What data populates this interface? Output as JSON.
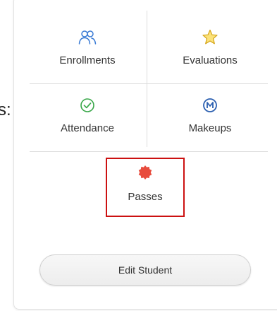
{
  "edge_text": "s:",
  "menu": {
    "enrollments": {
      "label": "Enrollments",
      "icon": "users-icon",
      "color": "#3a7bd5"
    },
    "evaluations": {
      "label": "Evaluations",
      "icon": "star-icon",
      "color": "#f2c230"
    },
    "attendance": {
      "label": "Attendance",
      "icon": "check-circle-icon",
      "color": "#3aa84a"
    },
    "makeups": {
      "label": "Makeups",
      "icon": "m-circle-icon",
      "color": "#2b5fb0"
    },
    "passes": {
      "label": "Passes",
      "icon": "badge-icon",
      "color": "#e84c3d"
    }
  },
  "edit_button": {
    "label": "Edit Student"
  },
  "colors": {
    "highlight": "#cc1111"
  }
}
